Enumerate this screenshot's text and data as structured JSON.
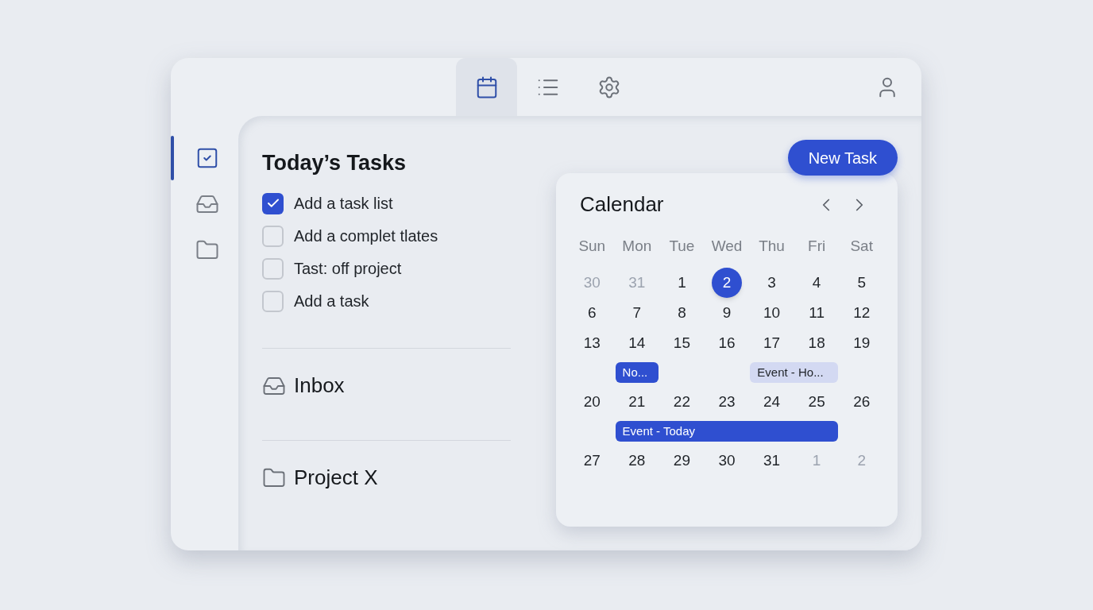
{
  "toolbar": {
    "tabs": [
      {
        "kind": "calendar",
        "selected": true
      },
      {
        "kind": "list",
        "selected": false
      },
      {
        "kind": "settings",
        "selected": false
      }
    ]
  },
  "sidebar": {
    "items": [
      {
        "kind": "tasks",
        "selected": true
      },
      {
        "kind": "inbox",
        "selected": false
      },
      {
        "kind": "folder",
        "selected": false
      }
    ]
  },
  "tasks": {
    "title": "Today’s Tasks",
    "items": [
      {
        "label": "Add a task list",
        "checked": true
      },
      {
        "label": "Add a complet tlates",
        "checked": false
      },
      {
        "label": "Tast: off project",
        "checked": false
      },
      {
        "label": "Add a task",
        "checked": false
      }
    ]
  },
  "sections": [
    {
      "kind": "inbox",
      "label": "Inbox"
    },
    {
      "kind": "folder",
      "label": "Project X"
    }
  ],
  "new_task_button": "New Task",
  "calendar": {
    "title": "Calendar",
    "weekdays": [
      "Sun",
      "Mon",
      "Tue",
      "Wed",
      "Thu",
      "Fri",
      "Sat"
    ],
    "weeks": [
      {
        "days": [
          {
            "label": "30",
            "muted": true,
            "selected": false
          },
          {
            "label": "31",
            "muted": true,
            "selected": false
          },
          {
            "label": "1",
            "muted": false,
            "selected": false
          },
          {
            "label": "2",
            "muted": false,
            "selected": true
          },
          {
            "label": "3",
            "muted": false,
            "selected": false
          },
          {
            "label": "4",
            "muted": false,
            "selected": false
          },
          {
            "label": "5",
            "muted": false,
            "selected": false
          }
        ]
      },
      {
        "days": [
          {
            "label": "6",
            "muted": false,
            "selected": false
          },
          {
            "label": "7",
            "muted": false,
            "selected": false
          },
          {
            "label": "8",
            "muted": false,
            "selected": false
          },
          {
            "label": "9",
            "muted": false,
            "selected": false
          },
          {
            "label": "10",
            "muted": false,
            "selected": false
          },
          {
            "label": "11",
            "muted": false,
            "selected": false
          },
          {
            "label": "12",
            "muted": false,
            "selected": false
          }
        ]
      },
      {
        "days": [
          {
            "label": "13",
            "muted": false,
            "selected": false
          },
          {
            "label": "14",
            "muted": false,
            "selected": false,
            "event": {
              "label": "No...",
              "kind": "primary"
            }
          },
          {
            "label": "15",
            "muted": false,
            "selected": false
          },
          {
            "label": "16",
            "muted": false,
            "selected": false
          },
          {
            "label": "17",
            "muted": false,
            "selected": false,
            "event": {
              "label": "Event - Ho...",
              "kind": "secondary"
            }
          },
          {
            "label": "18",
            "muted": false,
            "selected": false,
            "event_continues": true
          },
          {
            "label": "19",
            "muted": false,
            "selected": false
          }
        ]
      },
      {
        "days": [
          {
            "label": "20",
            "muted": false,
            "selected": false
          },
          {
            "label": "21",
            "muted": false,
            "selected": false,
            "event": {
              "label": "Event - Today",
              "kind": "primary"
            }
          },
          {
            "label": "22",
            "muted": false,
            "selected": false,
            "event_continues": true
          },
          {
            "label": "23",
            "muted": false,
            "selected": false,
            "event_continues": true
          },
          {
            "label": "24",
            "muted": false,
            "selected": false,
            "event_continues": true
          },
          {
            "label": "25",
            "muted": false,
            "selected": false,
            "event_continues": true
          },
          {
            "label": "26",
            "muted": false,
            "selected": false
          }
        ]
      },
      {
        "days": [
          {
            "label": "27",
            "muted": false,
            "selected": false
          },
          {
            "label": "28",
            "muted": false,
            "selected": false
          },
          {
            "label": "29",
            "muted": false,
            "selected": false
          },
          {
            "label": "30",
            "muted": false,
            "selected": false
          },
          {
            "label": "31",
            "muted": false,
            "selected": false
          },
          {
            "label": "1",
            "muted": true,
            "selected": false
          },
          {
            "label": "2",
            "muted": true,
            "selected": false
          }
        ]
      }
    ]
  }
}
